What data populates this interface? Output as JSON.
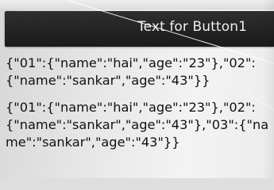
{
  "button": {
    "label": "Text for Button1"
  },
  "output": {
    "lines": [
      "{\"01\":{\"name\":\"hai\",\"age\":\"23\"},\"02\":{\"name\":\"sankar\",\"age\":\"43\"}}",
      "{\"01\":{\"name\":\"hai\",\"age\":\"23\"},\"02\":{\"name\":\"sankar\",\"age\":\"43\"},\"03\":{\"name\":\"sankar\",\"age\":\"43\"}}"
    ]
  }
}
